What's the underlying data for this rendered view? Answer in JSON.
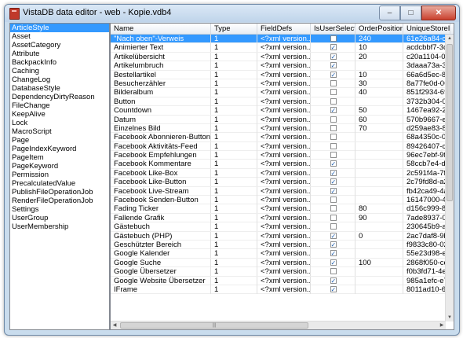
{
  "window": {
    "title": "VistaDB data editor - web - Kopie.vdb4",
    "icon": "database-icon",
    "buttons": {
      "minimize": "–",
      "maximize": "□",
      "close": "✕"
    }
  },
  "tables": {
    "selected": "ArticleStyle",
    "items": [
      "ArticleStyle",
      "Asset",
      "AssetCategory",
      "Attribute",
      "BackpackInfo",
      "Caching",
      "ChangeLog",
      "DatabaseStyle",
      "DependencyDirtyReason",
      "FileChange",
      "KeepAlive",
      "Lock",
      "MacroScript",
      "Page",
      "PageIndexKeyword",
      "PageItem",
      "PageKeyword",
      "Permission",
      "PrecalculatedValue",
      "PublishFileOperationJob",
      "RenderFileOperationJob",
      "Settings",
      "UserGroup",
      "UserMembership"
    ]
  },
  "grid": {
    "columns": [
      "Name",
      "Type",
      "FieldDefs",
      "IsUserSelectable",
      "OrderPosition",
      "UniqueStoreID"
    ],
    "rows": [
      {
        "name": "\"Nach oben\"-Verweis",
        "type": "1",
        "fielddefs": "<?xml version...",
        "selectable": false,
        "order": "240",
        "id": "61e26a84-c1...",
        "sel": true
      },
      {
        "name": "Animierter Text",
        "type": "1",
        "fielddefs": "<?xml version...",
        "selectable": true,
        "order": "10",
        "id": "acdcbbf7-3c8..."
      },
      {
        "name": "Artikelübersicht",
        "type": "1",
        "fielddefs": "<?xml version...",
        "selectable": true,
        "order": "20",
        "id": "c20a1104-0c1..."
      },
      {
        "name": "Artikelumbruch",
        "type": "1",
        "fielddefs": "<?xml version...",
        "selectable": true,
        "order": "",
        "id": "3daaa73a-30..."
      },
      {
        "name": "Bestellartikel",
        "type": "1",
        "fielddefs": "<?xml version...",
        "selectable": true,
        "order": "10",
        "id": "66a6d5ec-82..."
      },
      {
        "name": "Besucherzähler",
        "type": "1",
        "fielddefs": "<?xml version...",
        "selectable": false,
        "order": "30",
        "id": "8a77fe0d-061..."
      },
      {
        "name": "Bilderalbum",
        "type": "1",
        "fielddefs": "<?xml version...",
        "selectable": false,
        "order": "40",
        "id": "851f2934-698..."
      },
      {
        "name": "Button",
        "type": "1",
        "fielddefs": "<?xml version...",
        "selectable": false,
        "order": "",
        "id": "3732b304-07..."
      },
      {
        "name": "Countdown",
        "type": "1",
        "fielddefs": "<?xml version...",
        "selectable": true,
        "order": "50",
        "id": "1467ea92-2a..."
      },
      {
        "name": "Datum",
        "type": "1",
        "fielddefs": "<?xml version...",
        "selectable": false,
        "order": "60",
        "id": "570b9667-ec..."
      },
      {
        "name": "Einzelnes Bild",
        "type": "1",
        "fielddefs": "<?xml version...",
        "selectable": false,
        "order": "70",
        "id": "d259ae83-86..."
      },
      {
        "name": "Facebook Abonnieren-Button",
        "type": "1",
        "fielddefs": "<?xml version...",
        "selectable": false,
        "order": "",
        "id": "68a4350c-07..."
      },
      {
        "name": "Facebook Aktivitäts-Feed",
        "type": "1",
        "fielddefs": "<?xml version...",
        "selectable": false,
        "order": "",
        "id": "89426407-c3..."
      },
      {
        "name": "Facebook Empfehlungen",
        "type": "1",
        "fielddefs": "<?xml version...",
        "selectable": false,
        "order": "",
        "id": "96ec7ebf-9fe..."
      },
      {
        "name": "Facebook Kommentare",
        "type": "1",
        "fielddefs": "<?xml version...",
        "selectable": true,
        "order": "",
        "id": "58ccb7e4-daa..."
      },
      {
        "name": "Facebook Like-Box",
        "type": "1",
        "fielddefs": "<?xml version...",
        "selectable": true,
        "order": "",
        "id": "2c591f4a-7f8..."
      },
      {
        "name": "Facebook Like-Button",
        "type": "1",
        "fielddefs": "<?xml version...",
        "selectable": true,
        "order": "",
        "id": "2c79fd8d-a2a..."
      },
      {
        "name": "Facebook Live-Stream",
        "type": "1",
        "fielddefs": "<?xml version...",
        "selectable": true,
        "order": "",
        "id": "fb42ca49-4ab..."
      },
      {
        "name": "Facebook Senden-Button",
        "type": "1",
        "fielddefs": "<?xml version...",
        "selectable": false,
        "order": "",
        "id": "16147000-41..."
      },
      {
        "name": "Fading Ticker",
        "type": "1",
        "fielddefs": "<?xml version...",
        "selectable": false,
        "order": "80",
        "id": "d156c999-82..."
      },
      {
        "name": "Fallende Grafik",
        "type": "1",
        "fielddefs": "<?xml version...",
        "selectable": false,
        "order": "90",
        "id": "7ade8937-0f1..."
      },
      {
        "name": "Gästebuch",
        "type": "1",
        "fielddefs": "<?xml version...",
        "selectable": false,
        "order": "",
        "id": "230645b9-ae..."
      },
      {
        "name": "Gästebuch (PHP)",
        "type": "1",
        "fielddefs": "<?xml version...",
        "selectable": true,
        "order": "0",
        "id": "2ac7daf8-9b7..."
      },
      {
        "name": "Geschützter Bereich",
        "type": "1",
        "fielddefs": "<?xml version...",
        "selectable": true,
        "order": "",
        "id": "f9833c80-020..."
      },
      {
        "name": "Google Kalender",
        "type": "1",
        "fielddefs": "<?xml version...",
        "selectable": true,
        "order": "",
        "id": "55e23d98-e2..."
      },
      {
        "name": "Google Suche",
        "type": "1",
        "fielddefs": "<?xml version...",
        "selectable": true,
        "order": "100",
        "id": "2868f050-ced..."
      },
      {
        "name": "Google Übersetzer",
        "type": "1",
        "fielddefs": "<?xml version...",
        "selectable": false,
        "order": "",
        "id": "f0b3fd71-4e0..."
      },
      {
        "name": "Google Website Übersetzer",
        "type": "1",
        "fielddefs": "<?xml version...",
        "selectable": true,
        "order": "",
        "id": "985a1efc-e79..."
      },
      {
        "name": "IFrame",
        "type": "1",
        "fielddefs": "<?xml version...",
        "selectable": true,
        "order": "",
        "id": "8011ad10-6fc..."
      }
    ]
  },
  "scrollbar": {
    "up": "▲",
    "down": "▼",
    "left": "◀",
    "right": "▶",
    "grip": "|||"
  },
  "check_mark": "✓"
}
